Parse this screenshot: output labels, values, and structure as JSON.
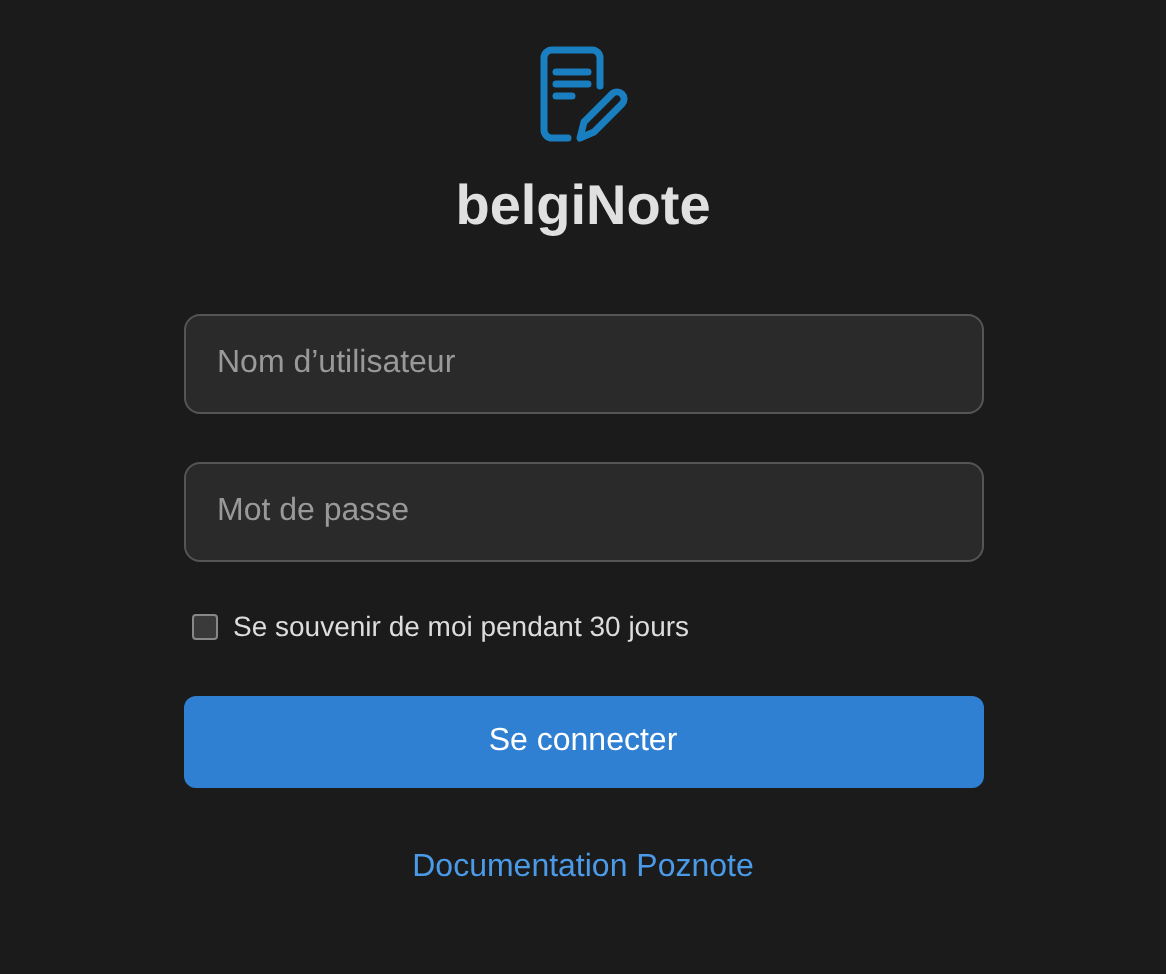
{
  "app": {
    "title": "belgiNote"
  },
  "username": {
    "placeholder": "Nom d’utilisateur"
  },
  "password": {
    "placeholder": "Mot de passe"
  },
  "remember": {
    "label": "Se souvenir de moi pendant 30 jours",
    "checked": false
  },
  "submit": {
    "label": "Se connecter"
  },
  "link": {
    "label": "Documentation Poznote"
  }
}
